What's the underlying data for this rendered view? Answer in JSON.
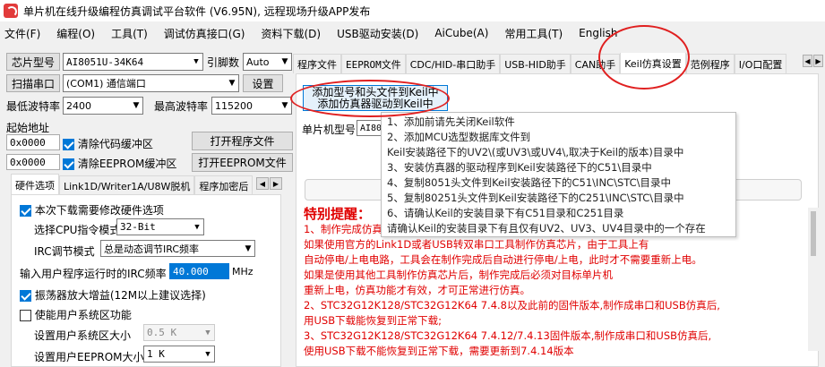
{
  "window": {
    "title": "单片机在线升级编程仿真调试平台软件 (V6.95N), 远程现场升级APP发布"
  },
  "menu": [
    "文件(F)",
    "编程(O)",
    "工具(T)",
    "调试仿真接口(G)",
    "资料下载(D)",
    "USB驱动安装(D)",
    "AiCube(A)",
    "常用工具(T)",
    "English"
  ],
  "left": {
    "chip_label": "芯片型号",
    "chip_value": "AI8051U-34K64",
    "pins_label": "引脚数",
    "pins_value": "Auto",
    "scan_label": "扫描串口",
    "port_value": "(COM1) 通信端口",
    "settings_label": "设置",
    "min_baud_label": "最低波特率",
    "min_baud_value": "2400",
    "max_baud_label": "最高波特率",
    "max_baud_value": "115200",
    "start_addr_label": "起始地址",
    "addr1": "0x0000",
    "clear_code": "清除代码缓冲区",
    "open_program": "打开程序文件",
    "addr2": "0x0000",
    "clear_eeprom": "清除EEPROM缓冲区",
    "open_eeprom": "打开EEPROM文件",
    "subtabs": [
      "硬件选项",
      "Link1D/Writer1A/U8W脱机",
      "程序加密后"
    ],
    "opt_modify": "本次下载需要修改硬件选项",
    "cpu_mode_label": "选择CPU指令模式",
    "cpu_mode_value": "32-Bit",
    "irc_mode_label": "IRC调节模式",
    "irc_mode_value": "总是动态调节IRC频率",
    "freq_label": "输入用户程序运行时的IRC频率",
    "freq_value": "40.000",
    "freq_unit": "MHz",
    "osc_gain": "振荡器放大增益(12M以上建议选择)",
    "user_sys": "使能用户系统区功能",
    "sys_size_label": "设置用户系统区大小",
    "sys_size_value": "0.5 K",
    "eeprom_size_label": "设置用户EEPROM大小",
    "eeprom_size_value": "1   K"
  },
  "right": {
    "tabs": [
      "程序文件",
      "EEPROM文件",
      "CDC/HID-串口助手",
      "USB-HID助手",
      "CAN助手",
      "Keil仿真设置",
      "范例程序",
      "I/O口配置"
    ],
    "add_keil_btn_l1": "添加型号和头文件到Keil中",
    "add_keil_btn_l2": "添加仿真器驱动到Keil中",
    "mcu_label": "单片机型号",
    "mcu_value": "AI805",
    "tooltip": [
      "1、添加前请先关闭Keil软件",
      "2、添加MCU选型数据库文件到",
      "    Keil安装路径下的UV2\\(或UV3\\或UV4\\,取决于Keil的版本)目录中",
      "3、安装仿真器的驱动程序到Keil安装路径下的C51\\目录中",
      "4、复制8051头文件到Keil安装路径下的C51\\INC\\STC\\目录中",
      "5、复制80251头文件到Keil安装路径下的C251\\INC\\STC\\目录中",
      "6、请确认Keil的安装目录下有C51目录和C251目录",
      "    请确认Keil的安装目录下有且仅有UV2、UV3、UV4目录中的一个存在"
    ],
    "warning_title": "特别提醒：",
    "warning_lines": [
      "1、制作完成仿真",
      "    如果使用官方的Link1D或者USB转双串口工具制作仿真芯片，由于工具上有",
      "    自动停电/上电电路，工具会在制作完成后自动进行停电/上电，此时才不需要重新上电。",
      "    如果是使用其他工具制作仿真芯片后，制作完成后必须对目标单片机",
      "    重新上电，仿真功能才有效，才可正常进行仿真。",
      "2、STC32G12K128/STC32G12K64   7.4.8以及此前的固件版本,制作成串口和USB仿真后,",
      "    用USB下载能恢复到正常下载;",
      "3、STC32G12K128/STC32G12K64   7.4.12/7.4.13固件版本,制作成串口和USB仿真后,",
      "    使用USB下载不能恢复到正常下载，需要更新到7.4.14版本"
    ]
  },
  "colors": {
    "annotation": "#e02020",
    "warning": "#e00000",
    "accent": "#0078d7"
  }
}
